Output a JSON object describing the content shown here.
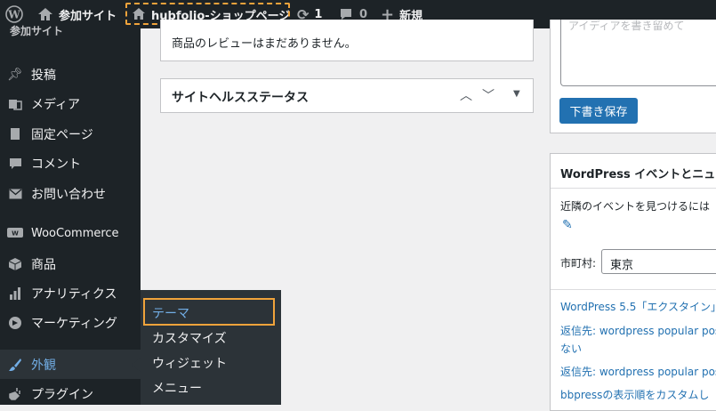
{
  "adminbar": {
    "site_name": "参加サイト",
    "shop_link": "hubfolio-ショップページ",
    "updates_count": "1",
    "comments_count": "0",
    "new_label": "新規"
  },
  "sidebar": {
    "truncated_top": "参加サイト",
    "items": [
      {
        "label": "投稿",
        "icon": "pin-icon"
      },
      {
        "label": "メディア",
        "icon": "media-icon"
      },
      {
        "label": "固定ページ",
        "icon": "page-icon"
      },
      {
        "label": "コメント",
        "icon": "comment-icon"
      },
      {
        "label": "お問い合わせ",
        "icon": "mail-icon"
      },
      {
        "label": "WooCommerce",
        "icon": "woo-icon"
      },
      {
        "label": "商品",
        "icon": "box-icon"
      },
      {
        "label": "アナリティクス",
        "icon": "chart-icon"
      },
      {
        "label": "マーケティング",
        "icon": "megaphone-icon"
      },
      {
        "label": "外観",
        "icon": "brush-icon"
      },
      {
        "label": "プラグイン",
        "icon": "plug-icon"
      }
    ],
    "submenu": [
      "テーマ",
      "カスタマイズ",
      "ウィジェット",
      "メニュー"
    ]
  },
  "main": {
    "reviews_text": "商品のレビューはまだありません。",
    "site_health_title": "サイトヘルスステータス",
    "draft_button": "下書き保存",
    "draft_placeholder_partial": "アイディアを書き留めて",
    "events_title": "WordPress イベントとニュー",
    "events_nearby": "近隣のイベントを見つけるには",
    "city_label": "市町村:",
    "city_value": "東京",
    "news": [
      "WordPress 5.5「エクスタイン」",
      "返信先: wordpress popular pos",
      "ない",
      "返信先: wordpress popular pos",
      "bbpressの表示順をカスタムし"
    ]
  },
  "colors": {
    "adminbar_bg": "#1d2327",
    "accent": "#2271b1",
    "highlight_outline": "#f0a33b"
  }
}
